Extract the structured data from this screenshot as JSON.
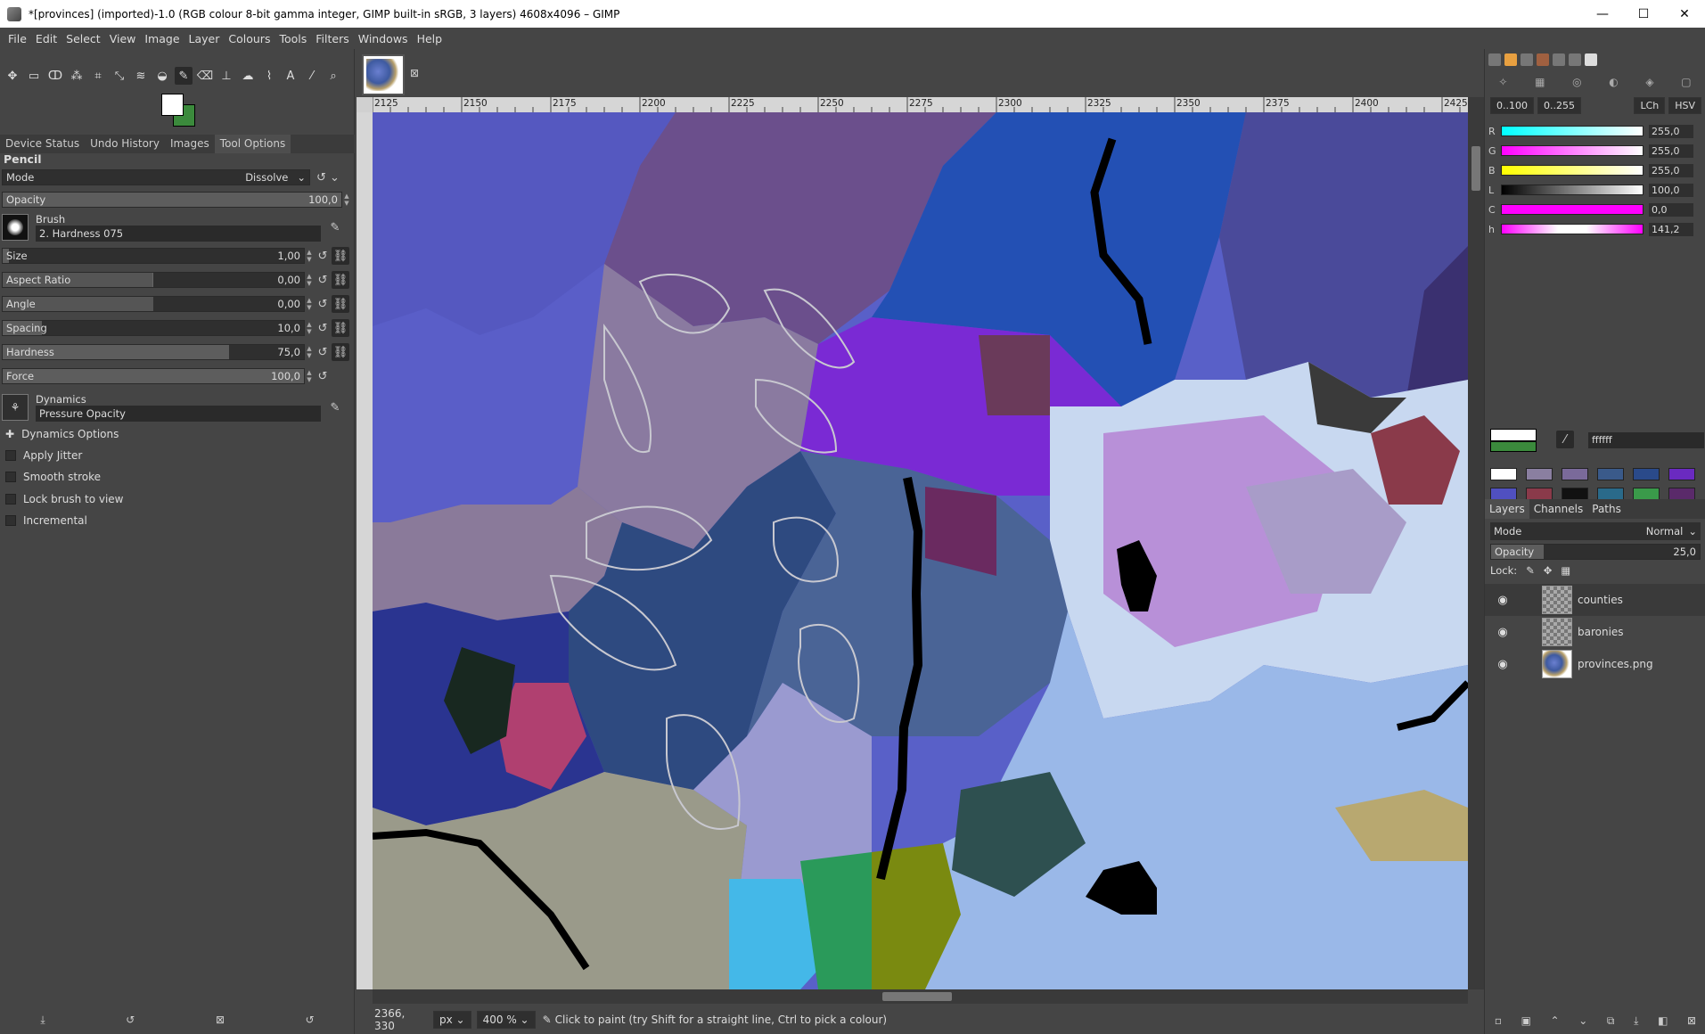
{
  "window": {
    "title": "*[provinces] (imported)-1.0 (RGB colour 8-bit gamma integer, GIMP built-in sRGB, 3 layers) 4608x4096 – GIMP",
    "minimize": "—",
    "maximize": "☐",
    "close": "✕"
  },
  "menu": [
    "File",
    "Edit",
    "Select",
    "View",
    "Image",
    "Layer",
    "Colours",
    "Tools",
    "Filters",
    "Windows",
    "Help"
  ],
  "dock_tabs": [
    "Device Status",
    "Undo History",
    "Images",
    "Tool Options"
  ],
  "tool_options": {
    "tool_name": "Pencil",
    "mode_label": "Mode",
    "mode_value": "Dissolve",
    "opacity_label": "Opacity",
    "opacity_value": "100,0",
    "brush_label": "Brush",
    "brush_name": "2. Hardness 075",
    "size_label": "Size",
    "size_value": "1,00",
    "aspect_label": "Aspect Ratio",
    "aspect_value": "0,00",
    "angle_label": "Angle",
    "angle_value": "0,00",
    "spacing_label": "Spacing",
    "spacing_value": "10,0",
    "hardness_label": "Hardness",
    "hardness_value": "75,0",
    "force_label": "Force",
    "force_value": "100,0",
    "dynamics_label": "Dynamics",
    "dynamics_name": "Pressure Opacity",
    "dynamics_options": "Dynamics Options",
    "apply_jitter": "Apply Jitter",
    "smooth_stroke": "Smooth stroke",
    "lock_brush": "Lock brush to view",
    "incremental": "Incremental"
  },
  "ruler_ticks": [
    "2125",
    "2150",
    "2175",
    "2200",
    "2225",
    "2250",
    "2275",
    "2300",
    "2325",
    "2350",
    "2375",
    "2400",
    "2425"
  ],
  "status": {
    "coords": "2366, 330",
    "unit": "px",
    "zoom": "400 %",
    "message": "Click to paint (try Shift for a straight line, Ctrl to pick a colour)"
  },
  "colour_panel": {
    "range_a": "0..100",
    "range_b": "0..255",
    "mode_lch": "LCh",
    "mode_hsv": "HSV",
    "channels": [
      {
        "ch": "R",
        "value": "255,0",
        "grad": "linear-gradient(90deg,#00ffff,#ffffff)"
      },
      {
        "ch": "G",
        "value": "255,0",
        "grad": "linear-gradient(90deg,#ff00ff,#ffffff)"
      },
      {
        "ch": "B",
        "value": "255,0",
        "grad": "linear-gradient(90deg,#ffff00,#ffffff)"
      },
      {
        "ch": "L",
        "value": "100,0",
        "grad": "linear-gradient(90deg,#000000,#ffffff)"
      },
      {
        "ch": "C",
        "value": "0,0",
        "grad": "linear-gradient(90deg,#ff00ff,#ff00ff)"
      },
      {
        "ch": "h",
        "value": "141,2",
        "grad": "linear-gradient(90deg,#ff00ff,#ffffff 40%,#ffffff 60%,#ff00ff)"
      }
    ],
    "hex": "ffffff",
    "swatches": [
      "#ffffff",
      "#8a7fa0",
      "#7a6a9a",
      "#3a5a8a",
      "#2a4a8a",
      "#6a2ac0",
      "#5050c0",
      "#8a3a4a",
      "#111111",
      "#2a6a8a",
      "#3a9a4a",
      "#5a2a6a"
    ]
  },
  "layers_panel": {
    "tabs": [
      "Layers",
      "Channels",
      "Paths"
    ],
    "mode_label": "Mode",
    "mode_value": "Normal",
    "opacity_label": "Opacity",
    "opacity_value": "25,0",
    "lock_label": "Lock:",
    "layers": [
      {
        "name": "counties",
        "selected": true
      },
      {
        "name": "baronies",
        "selected": false
      },
      {
        "name": "provinces.png",
        "selected": false
      }
    ]
  },
  "map_region_colors": [
    "#5960c8",
    "#6b4f8c",
    "#2350b4",
    "#8a7aa0",
    "#7a5ab0",
    "#7a2ad4",
    "#2e4a80",
    "#4a6496",
    "#6a2a60",
    "#c8d8f0",
    "#9ab8e8",
    "#b890d8",
    "#6a6ab0",
    "#3a3a3a"
  ]
}
